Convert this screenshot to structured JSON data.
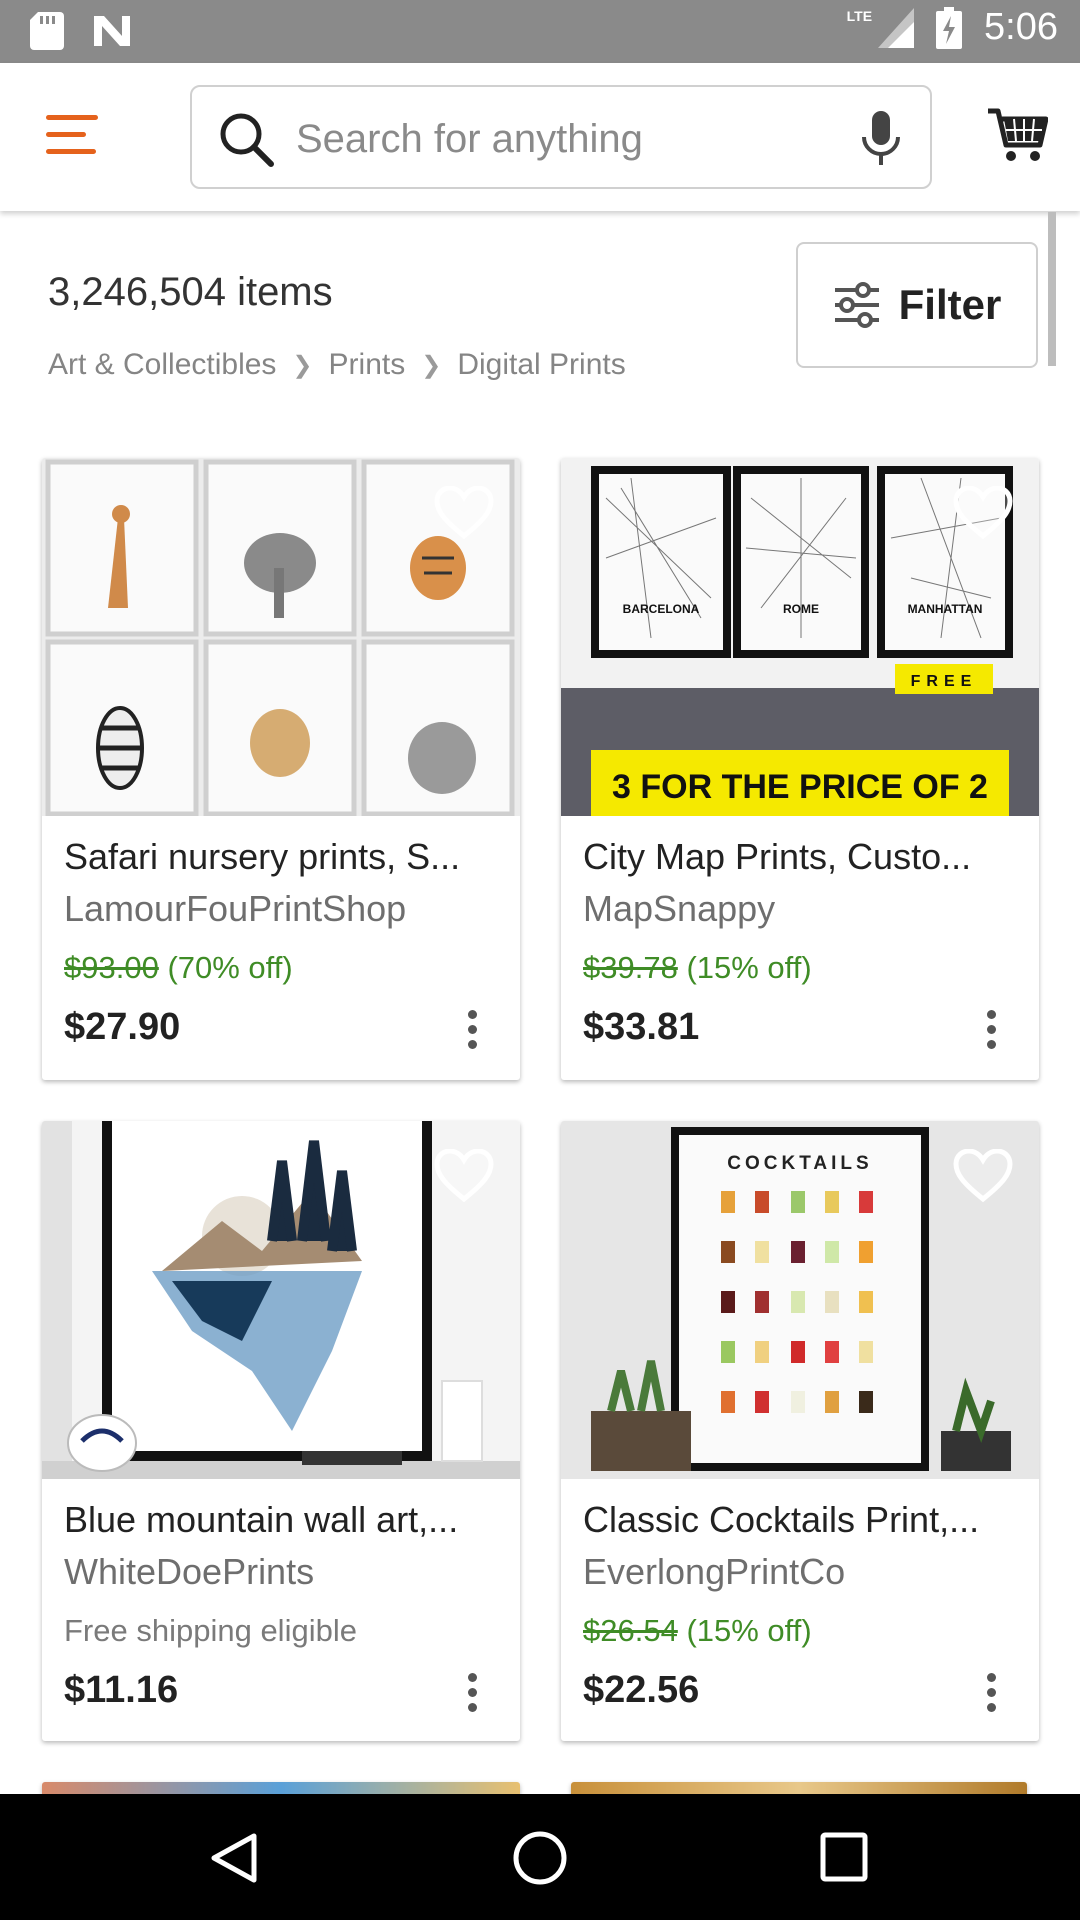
{
  "status_bar": {
    "time": "5:06",
    "network": "LTE",
    "left_icons": [
      "sd-card-icon",
      "n-notification-icon"
    ],
    "right_icons": [
      "signal-icon",
      "battery-charging-icon"
    ]
  },
  "header": {
    "menu_icon": "hamburger-menu-icon",
    "search_placeholder": "Search for anything",
    "search_icon": "search-icon",
    "mic_icon": "microphone-icon",
    "cart_icon": "cart-icon",
    "accent_color": "#e5621c"
  },
  "results": {
    "count": "3,246,504 items",
    "breadcrumb": [
      "Art & Collectibles",
      "Prints",
      "Digital Prints"
    ],
    "filter_label": "Filter"
  },
  "listings": [
    {
      "title": "Safari nursery prints, S...",
      "shop": "LamourFouPrintShop",
      "original_price": "$93.00",
      "discount": "(70% off)",
      "price": "$27.90"
    },
    {
      "title": "City Map Prints, Custo...",
      "shop": "MapSnappy",
      "original_price": "$39.78",
      "discount": "(15% off)",
      "price": "$33.81",
      "image_text": {
        "cities": [
          "BARCELONA",
          "ROME",
          "MANHATTAN"
        ],
        "free_tag": "FREE",
        "banner": "3 FOR THE PRICE OF 2"
      }
    },
    {
      "title": "Blue mountain wall art,...",
      "shop": "WhiteDoePrints",
      "shipping": "Free shipping eligible",
      "price": "$11.16"
    },
    {
      "title": "Classic Cocktails Print,...",
      "shop": "EverlongPrintCo",
      "original_price": "$26.54",
      "discount": "(15% off)",
      "price": "$22.56",
      "image_text": {
        "poster_title": "COCKTAILS"
      }
    }
  ],
  "colors": {
    "discount_green": "#3f8c26",
    "status_bar": "#8a8a8a",
    "nav_bar": "#000000"
  },
  "nav_bar": {
    "icons": [
      "back-icon",
      "home-icon",
      "recents-icon"
    ]
  }
}
